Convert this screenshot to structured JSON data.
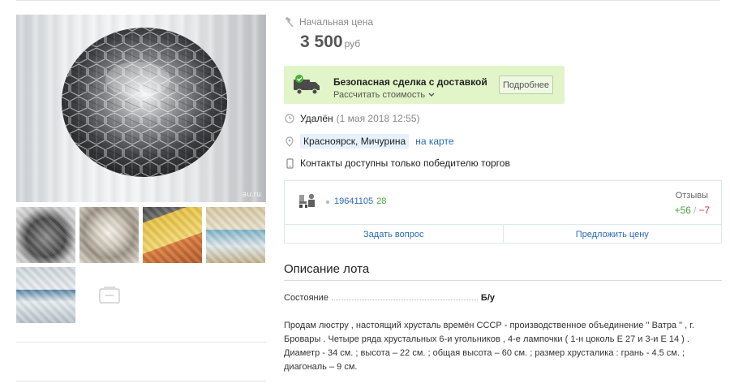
{
  "gallery": {
    "watermark": "au.ru"
  },
  "price": {
    "label": "Начальная цена",
    "amount": "3 500",
    "currency": "руб"
  },
  "safe_deal": {
    "title": "Безопасная сделка с доставкой",
    "calc_label": "Рассчитать стоимость",
    "more_button": "Подробнее"
  },
  "details": {
    "status": "Удалён",
    "status_date": "(1 мая 2018 12:55)",
    "location": "Красноярск, Мичурина",
    "map_link": "на карте",
    "contacts": "Контакты доступны только победителю торгов"
  },
  "seller": {
    "user_id": "19641105",
    "rating": "28",
    "reviews_label": "Отзывы",
    "reviews_positive": "+56",
    "reviews_separator": "/",
    "reviews_negative": "−7",
    "ask_button": "Задать вопрос",
    "offer_button": "Предложить цену"
  },
  "description": {
    "title": "Описание лота",
    "condition_label": "Состояние",
    "condition_value": "Б/у",
    "text": "Продам люстру , настоящий хрусталь времён СССР - производственное объединение \" Ватра \" , г. Бровары . Четыре ряда хрустальных 6-и угольников , 4-е лампочки ( 1-н цоколь Е 27 и 3-и Е 14 ) . Диаметр - 34 см. ; высота – 22 см. ; общая высота – 60 см. ; размер хрусталика : грань - 4.5 см. ; диагональ – 9 см."
  },
  "colors": {
    "accent_link": "#2a6bb8",
    "safe_deal_bg": "#e1f5c8",
    "positive": "#4aa33b",
    "negative": "#d83a3a"
  }
}
